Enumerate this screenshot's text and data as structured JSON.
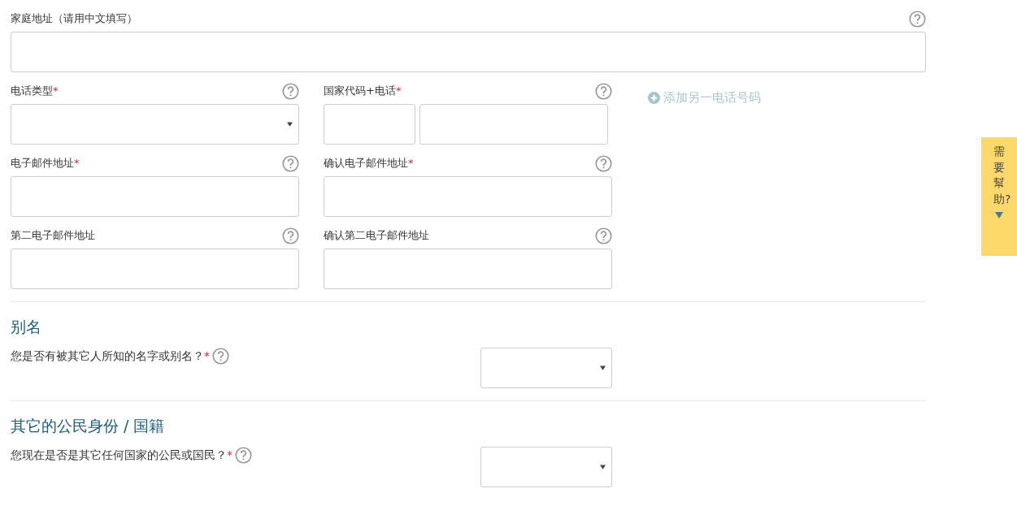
{
  "address": {
    "label": "家庭地址（请用中文填写）"
  },
  "contact_fields": [
    {
      "label": "电话类型",
      "required_mark": "*",
      "kind": "select"
    },
    {
      "label": "国家代码+电话",
      "required_mark": "*",
      "kind": "phone"
    },
    {
      "label": "电子邮件地址",
      "required_mark": "*",
      "kind": "text"
    },
    {
      "label": "确认电子邮件地址",
      "required_mark": "*",
      "kind": "text"
    },
    {
      "label": "第二电子邮件地址",
      "kind": "text"
    },
    {
      "label": "确认第二电子邮件地址",
      "kind": "text"
    }
  ],
  "add_phone": {
    "label": "添加另一电话号码"
  },
  "sections": [
    {
      "title": "别名",
      "question": "您是否有被其它人所知的名字或别名？",
      "required_mark": "*"
    },
    {
      "title": "其它的公民身份 / 国籍",
      "question": "您现在是否是其它任何国家的公民或国民？",
      "required_mark": "*"
    }
  ],
  "help_tab": {
    "label": "需要幫助?"
  }
}
